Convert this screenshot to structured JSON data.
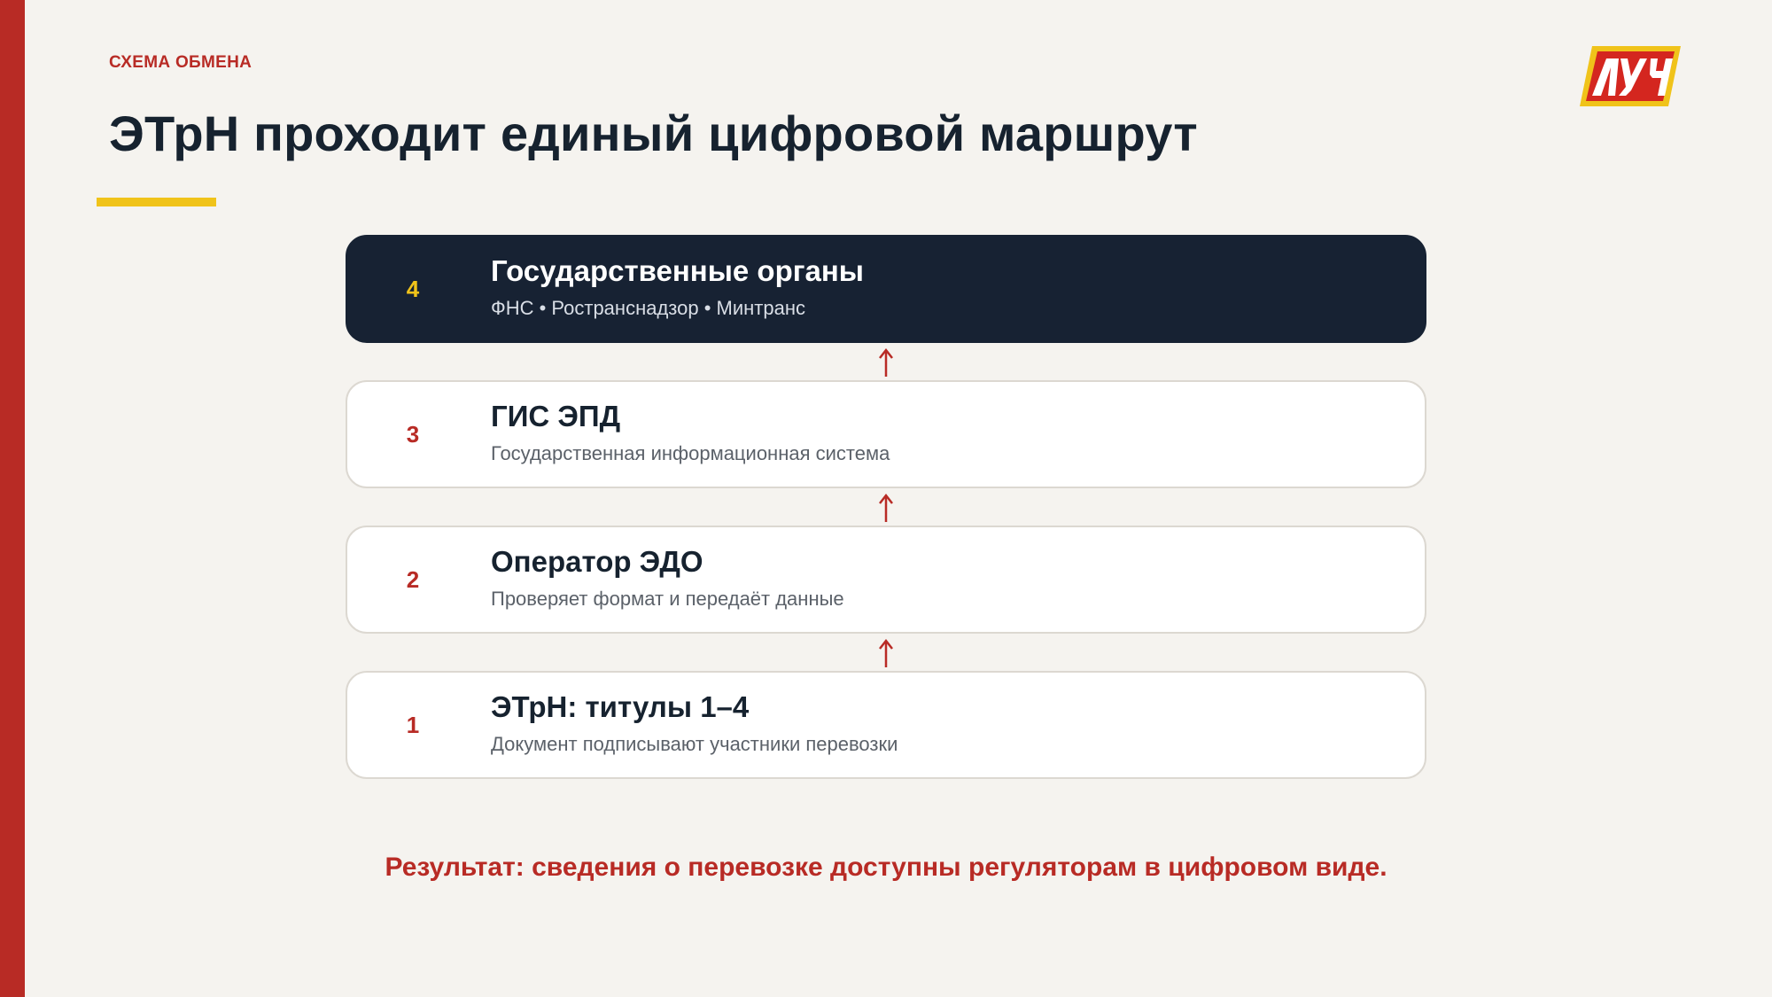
{
  "header": {
    "eyebrow": "СХЕМА ОБМЕНА",
    "title": "ЭТрН проходит единый цифровой маршрут",
    "logo_text": "ЛУЧ"
  },
  "colors": {
    "accent_red": "#b82b25",
    "accent_yellow": "#f0c31a",
    "dark_navy": "#172233",
    "background": "#f5f3ef"
  },
  "steps": [
    {
      "number": "4",
      "title": "Государственные органы",
      "subtitle": "ФНС • Ространснадзор • Минтранс"
    },
    {
      "number": "3",
      "title": "ГИС ЭПД",
      "subtitle": "Государственная информационная система"
    },
    {
      "number": "2",
      "title": "Оператор ЭДО",
      "subtitle": "Проверяет формат и передаёт данные"
    },
    {
      "number": "1",
      "title": "ЭТрН: титулы 1–4",
      "subtitle": "Документ подписывают участники перевозки"
    }
  ],
  "connector_icon": "arrow-up-icon",
  "result": "Результат: сведения о перевозке доступны регуляторам в цифровом виде."
}
